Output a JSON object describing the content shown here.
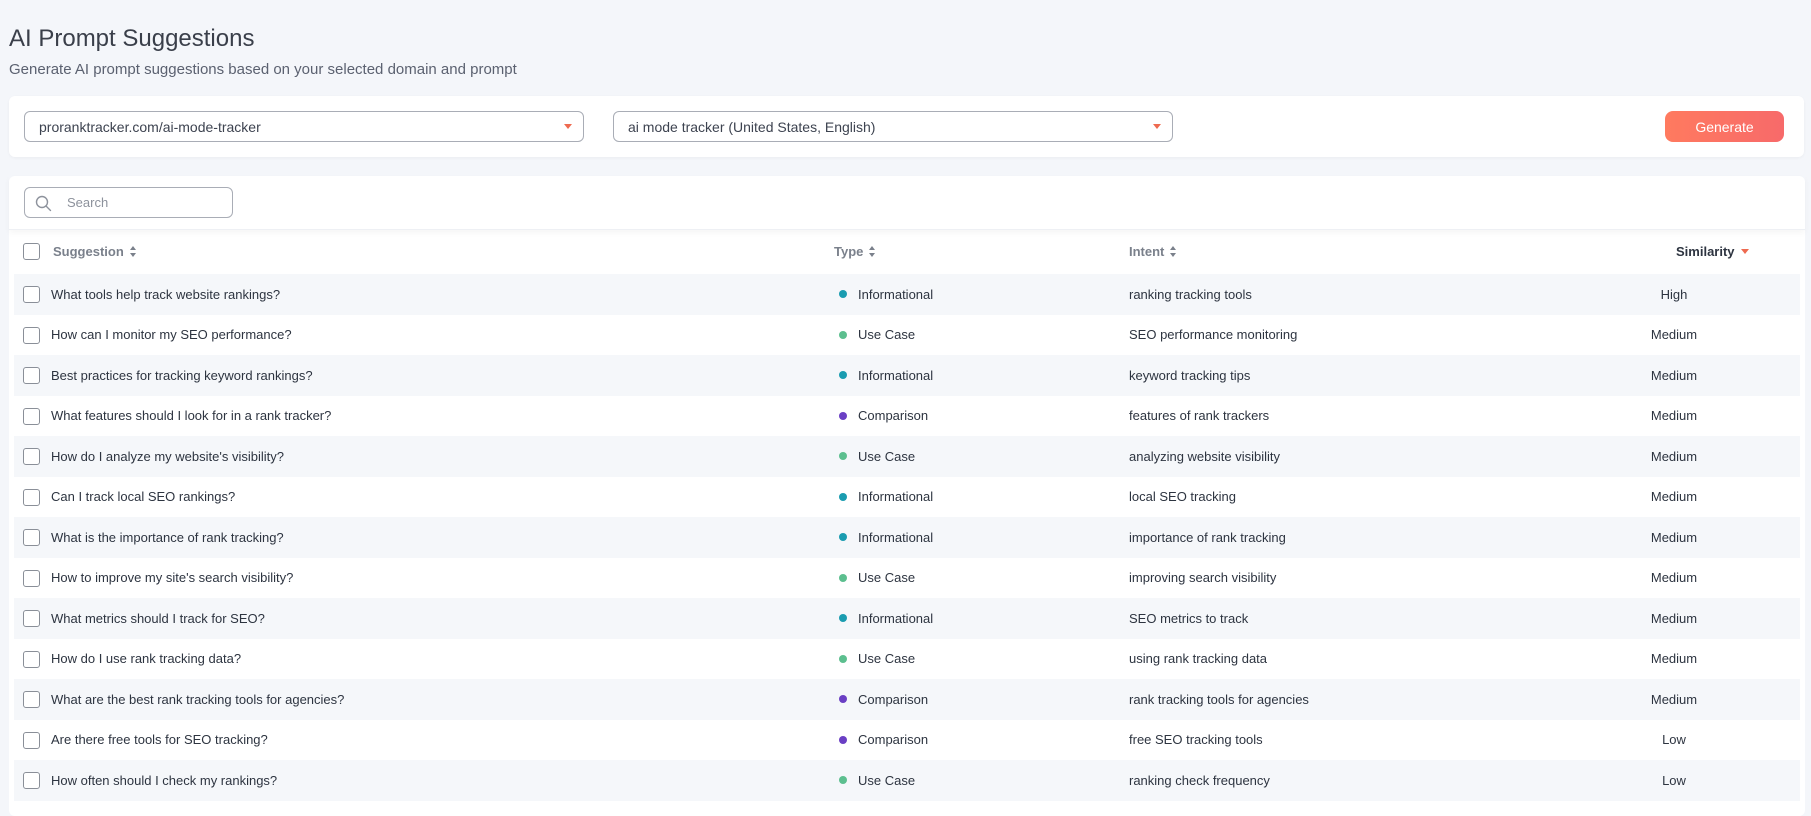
{
  "header": {
    "title": "AI Prompt Suggestions",
    "subtitle": "Generate AI prompt suggestions based on your selected domain and prompt"
  },
  "controls": {
    "domain_value": "proranktracker.com/ai-mode-tracker",
    "prompt_value": "ai mode tracker (United States, English)",
    "generate_label": "Generate"
  },
  "search": {
    "placeholder": "Search"
  },
  "columns": {
    "suggestion": "Suggestion",
    "type": "Type",
    "intent": "Intent",
    "similarity": "Similarity"
  },
  "type_colors": {
    "Informational": "#1a9cb0",
    "Use Case": "#5cbf8f",
    "Comparison": "#6a3fc4"
  },
  "rows": [
    {
      "suggestion": "What tools help track website rankings?",
      "type": "Informational",
      "intent": "ranking tracking tools",
      "similarity": "High"
    },
    {
      "suggestion": "How can I monitor my SEO performance?",
      "type": "Use Case",
      "intent": "SEO performance monitoring",
      "similarity": "Medium"
    },
    {
      "suggestion": "Best practices for tracking keyword rankings?",
      "type": "Informational",
      "intent": "keyword tracking tips",
      "similarity": "Medium"
    },
    {
      "suggestion": "What features should I look for in a rank tracker?",
      "type": "Comparison",
      "intent": "features of rank trackers",
      "similarity": "Medium"
    },
    {
      "suggestion": "How do I analyze my website's visibility?",
      "type": "Use Case",
      "intent": "analyzing website visibility",
      "similarity": "Medium"
    },
    {
      "suggestion": "Can I track local SEO rankings?",
      "type": "Informational",
      "intent": "local SEO tracking",
      "similarity": "Medium"
    },
    {
      "suggestion": "What is the importance of rank tracking?",
      "type": "Informational",
      "intent": "importance of rank tracking",
      "similarity": "Medium"
    },
    {
      "suggestion": "How to improve my site's search visibility?",
      "type": "Use Case",
      "intent": "improving search visibility",
      "similarity": "Medium"
    },
    {
      "suggestion": "What metrics should I track for SEO?",
      "type": "Informational",
      "intent": "SEO metrics to track",
      "similarity": "Medium"
    },
    {
      "suggestion": "How do I use rank tracking data?",
      "type": "Use Case",
      "intent": "using rank tracking data",
      "similarity": "Medium"
    },
    {
      "suggestion": "What are the best rank tracking tools for agencies?",
      "type": "Comparison",
      "intent": "rank tracking tools for agencies",
      "similarity": "Medium"
    },
    {
      "suggestion": "Are there free tools for SEO tracking?",
      "type": "Comparison",
      "intent": "free SEO tracking tools",
      "similarity": "Low"
    },
    {
      "suggestion": "How often should I check my rankings?",
      "type": "Use Case",
      "intent": "ranking check frequency",
      "similarity": "Low"
    }
  ]
}
